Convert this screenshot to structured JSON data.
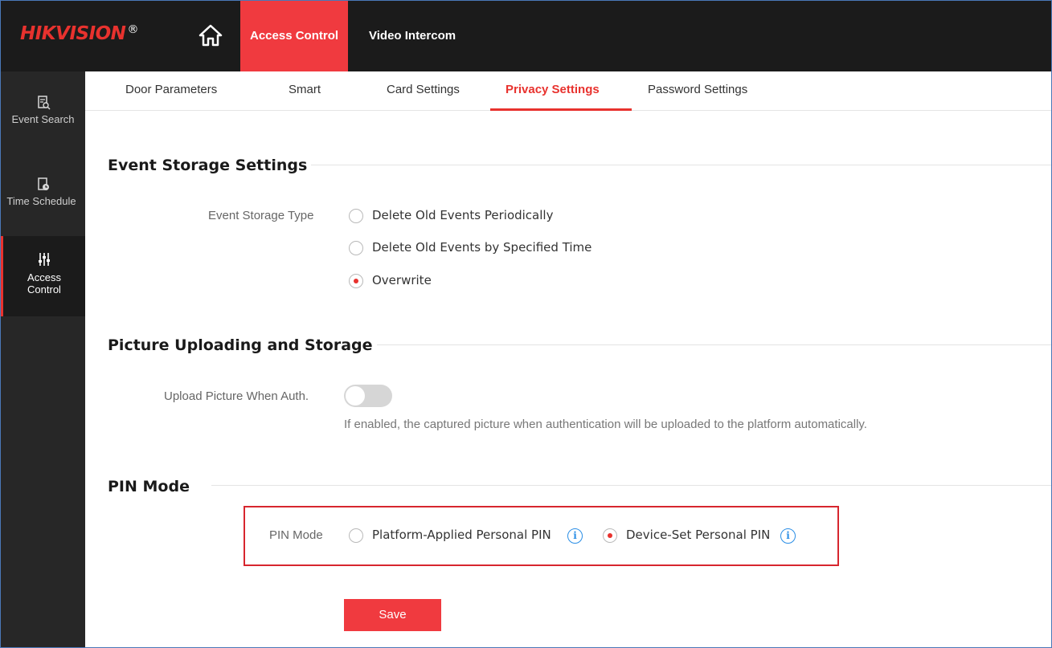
{
  "brand": {
    "logo_main": "HIK",
    "logo_rest": "VISION",
    "logo_reg": "®"
  },
  "topnav": {
    "home_icon": "home-icon",
    "tabs": [
      {
        "label": "Access Control",
        "active": true
      },
      {
        "label": "Video Intercom",
        "active": false
      }
    ]
  },
  "sidebar": {
    "items": [
      {
        "label": "Event Search",
        "icon": "event-search-icon"
      },
      {
        "label": "Time Schedule",
        "icon": "time-schedule-icon"
      },
      {
        "label": "Access Control",
        "label_line1": "Access",
        "label_line2": "Control",
        "icon": "sliders-icon",
        "active": true
      }
    ]
  },
  "subtabs": [
    {
      "label": "Door Parameters"
    },
    {
      "label": "Smart"
    },
    {
      "label": "Card Settings"
    },
    {
      "label": "Privacy Settings",
      "active": true
    },
    {
      "label": "Password Settings"
    }
  ],
  "event_storage": {
    "title": "Event Storage Settings",
    "type_label": "Event Storage Type",
    "options": [
      {
        "label": "Delete Old Events Periodically",
        "checked": false
      },
      {
        "label": "Delete Old Events by Specified Time",
        "checked": false
      },
      {
        "label": "Overwrite",
        "checked": true
      }
    ]
  },
  "picture": {
    "title": "Picture Uploading and Storage",
    "upload_label": "Upload Picture When Auth.",
    "upload_enabled": false,
    "hint": "If enabled, the captured picture when authentication will be uploaded to the platform automatically."
  },
  "pin": {
    "title": "PIN Mode",
    "label": "PIN Mode",
    "options": [
      {
        "label": "Platform-Applied Personal PIN",
        "checked": false
      },
      {
        "label": "Device-Set Personal PIN",
        "checked": true
      }
    ],
    "info_glyph": "i"
  },
  "actions": {
    "save_label": "Save"
  },
  "colors": {
    "accent": "#f03a3f",
    "topbar": "#1b1b1b",
    "sidebar": "#272727",
    "info": "#2a8ee6"
  }
}
